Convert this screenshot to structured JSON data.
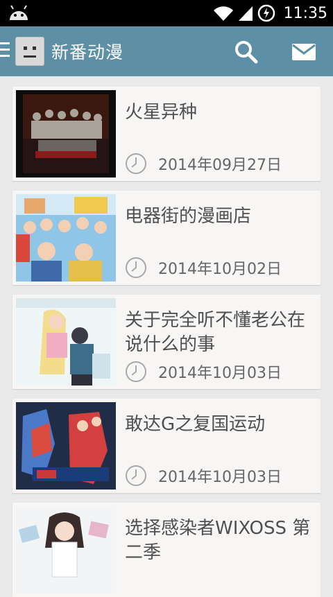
{
  "status_bar": {
    "time": "11:35"
  },
  "action_bar": {
    "title": "新番动漫"
  },
  "items": [
    {
      "title": "火星异种",
      "date": "2014年09月27日"
    },
    {
      "title": "电器街的漫画店",
      "date": "2014年10月02日"
    },
    {
      "title": "关于完全听不懂老公在说什么的事",
      "date": "2014年10月03日"
    },
    {
      "title": "敢达G之复国运动",
      "date": "2014年10月03日"
    },
    {
      "title": "选择感染者WIXOSS 第二季",
      "date": ""
    }
  ],
  "colors": {
    "action_bar": "#5d8fa6",
    "card": "#f7f6f5",
    "background": "#e9e9e9"
  },
  "icons": [
    "android-icon",
    "wifi-icon",
    "signal-icon",
    "sync-icon",
    "menu-icon",
    "search-icon",
    "mail-icon",
    "clock-icon"
  ]
}
